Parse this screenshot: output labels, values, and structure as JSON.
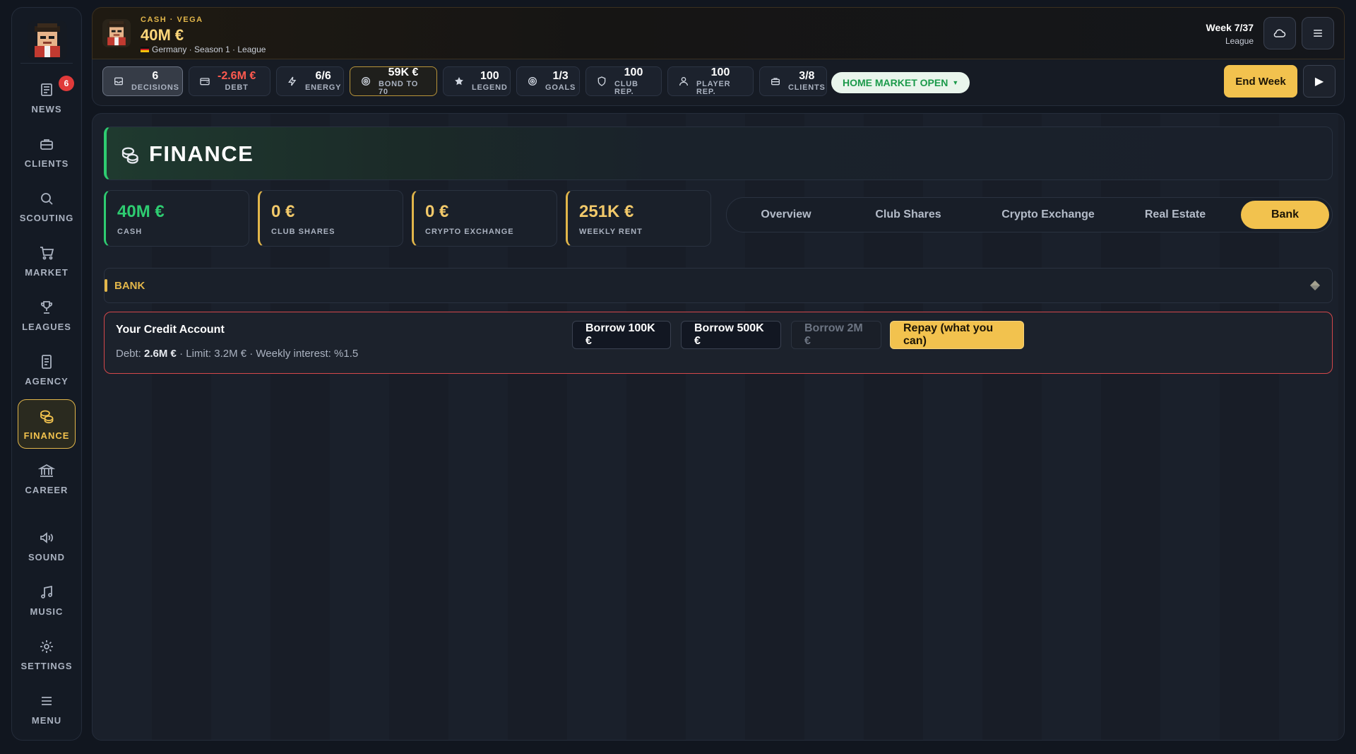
{
  "sidebar": {
    "items": [
      {
        "label": "NEWS",
        "badge": "6"
      },
      {
        "label": "CLIENTS"
      },
      {
        "label": "SCOUTING"
      },
      {
        "label": "MARKET"
      },
      {
        "label": "LEAGUES"
      },
      {
        "label": "AGENCY"
      },
      {
        "label": "FINANCE",
        "active": true
      },
      {
        "label": "CAREER"
      },
      {
        "label": "SOUND"
      },
      {
        "label": "MUSIC"
      },
      {
        "label": "SETTINGS"
      },
      {
        "label": "MENU"
      }
    ]
  },
  "header": {
    "kicker": "CASH · VEGA",
    "cash": "40M €",
    "subtitle": "Germany · Season 1 · League",
    "week": "Week 7/37",
    "week_sub": "League"
  },
  "stats": {
    "decisions": {
      "value": "6",
      "label": "DECISIONS"
    },
    "debt": {
      "value": "-2.6M €",
      "label": "DEBT"
    },
    "energy": {
      "value": "6/6",
      "label": "ENERGY"
    },
    "bond": {
      "value": "59K €",
      "label": "BOND TO 70"
    },
    "legend": {
      "value": "100",
      "label": "LEGEND"
    },
    "goals": {
      "value": "1/3",
      "label": "GOALS"
    },
    "club_rep": {
      "value": "100",
      "label": "CLUB REP."
    },
    "player_rep": {
      "value": "100",
      "label": "PLAYER REP."
    },
    "clients": {
      "value": "3/8",
      "label": "CLIENTS"
    },
    "market": "HOME MARKET OPEN",
    "end_week": "End Week",
    "play": "▶"
  },
  "finance": {
    "title": "FINANCE",
    "cards": [
      {
        "value": "40M €",
        "label": "CASH"
      },
      {
        "value": "0 €",
        "label": "CLUB SHARES"
      },
      {
        "value": "0 €",
        "label": "CRYPTO EXCHANGE"
      },
      {
        "value": "251K €",
        "label": "WEEKLY RENT"
      }
    ],
    "tabs": [
      "Overview",
      "Club Shares",
      "Crypto Exchange",
      "Real Estate",
      "Bank"
    ],
    "active_tab": "Bank",
    "section_title": "BANK",
    "credit": {
      "title": "Your Credit Account",
      "debt_label": "Debt:",
      "debt_value": "2.6M €",
      "rest": "· Limit: 3.2M € · Weekly interest: %1.5",
      "buttons": {
        "borrow_100k": "Borrow 100K €",
        "borrow_500k": "Borrow 500K €",
        "borrow_2m": "Borrow 2M €",
        "repay": "Repay (what you can)"
      }
    }
  },
  "colors": {
    "accent_gold": "#f2c24e",
    "positive_green": "#2ecc71",
    "negative_red": "#ff5a4f",
    "debt_border": "#d4474a"
  }
}
